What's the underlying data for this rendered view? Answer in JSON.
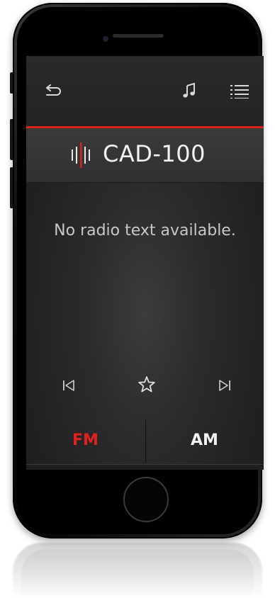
{
  "toolbar": {
    "back_icon": "back-arrow-icon",
    "music_icon": "music-note-icon",
    "menu_icon": "list-menu-icon"
  },
  "station": {
    "name": "CAD-100",
    "logo_icon": "sound-wave-icon"
  },
  "radio_text": "No radio text available.",
  "controls": {
    "previous_icon": "skip-previous-icon",
    "favorite_icon": "star-outline-icon",
    "next_icon": "skip-next-icon"
  },
  "bands": [
    {
      "label": "FM",
      "selected": true
    },
    {
      "label": "AM",
      "selected": false
    }
  ],
  "colors": {
    "accent": "#d9231a",
    "active_band": "#e0231a",
    "text": "#f2f2f2"
  }
}
